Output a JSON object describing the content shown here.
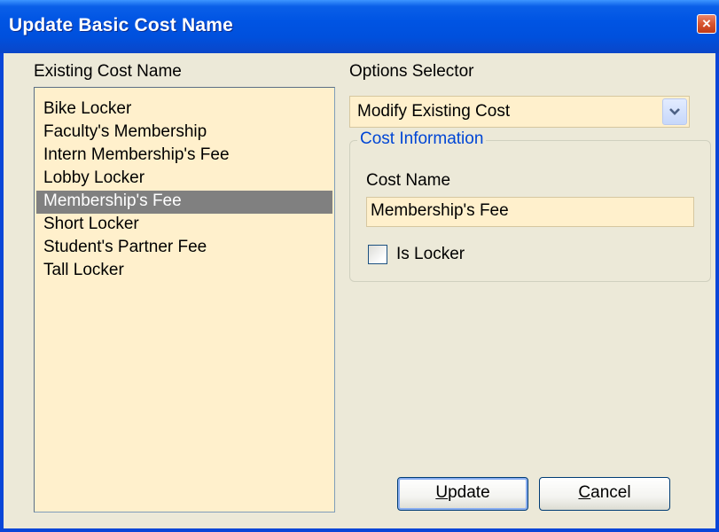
{
  "window": {
    "title": "Update Basic Cost Name",
    "close_glyph": "×"
  },
  "left": {
    "label": "Existing Cost Name",
    "items": [
      {
        "label": "Bike Locker",
        "selected": false
      },
      {
        "label": "Faculty's Membership",
        "selected": false
      },
      {
        "label": "Intern Membership's Fee",
        "selected": false
      },
      {
        "label": "Lobby Locker",
        "selected": false
      },
      {
        "label": "Membership's Fee",
        "selected": true
      },
      {
        "label": "Short Locker",
        "selected": false
      },
      {
        "label": "Student's Partner Fee",
        "selected": false
      },
      {
        "label": "Tall Locker",
        "selected": false
      }
    ]
  },
  "options": {
    "label": "Options Selector",
    "selected": "Modify Existing Cost"
  },
  "cost_info": {
    "legend": "Cost Information",
    "name_label": "Cost Name",
    "name_value": "Membership's Fee",
    "locker_label": "Is Locker",
    "locker_checked": false
  },
  "buttons": {
    "update": {
      "mnemonic": "U",
      "rest": "pdate"
    },
    "cancel": {
      "mnemonic": "C",
      "rest": "ancel"
    }
  },
  "colors": {
    "titlebar": "#0054e3",
    "field_background": "#fff0cc",
    "selection": "#808080",
    "group_legend": "#0046d5"
  },
  "icons": {
    "close": "close-icon",
    "dropdown": "chevron-down-icon",
    "checkbox": "checkbox-icon"
  }
}
